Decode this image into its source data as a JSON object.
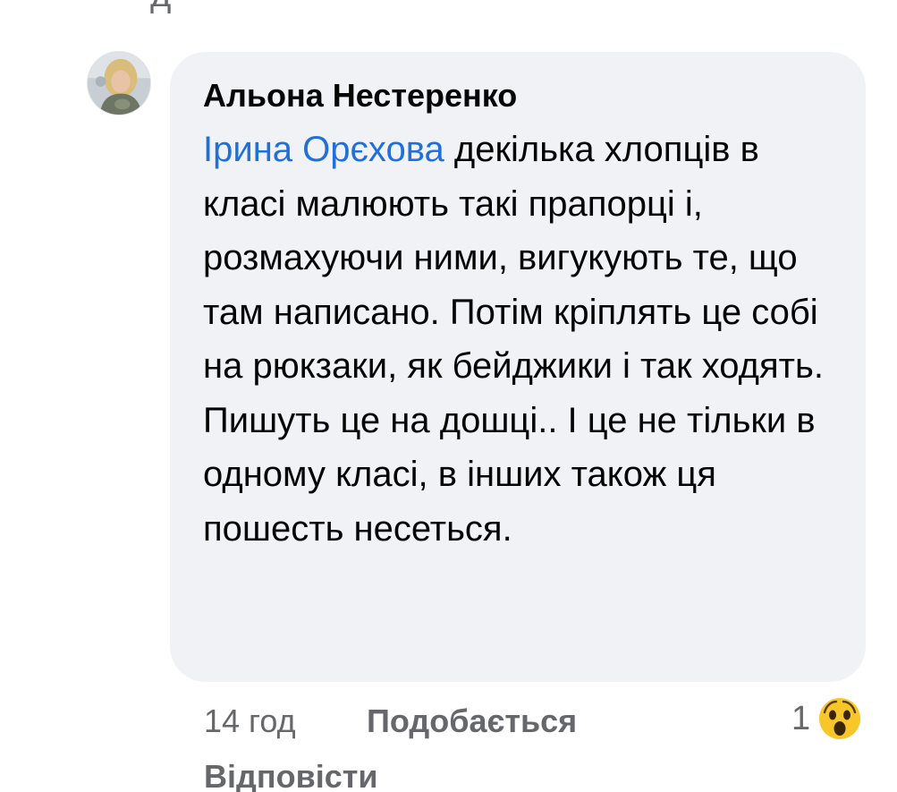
{
  "previous_fragment": "д",
  "comment": {
    "author": "Альона Нестеренко",
    "mention": "Ірина Орєхова",
    "text": " декілька хлопців в класі малюють такі прапорці і, розмахуючи ними, вигукують те, що там написано. Потім кріплять це собі на рюкзаки, як бейджики і так ходять. Пишуть це на дошці.. І це не тільки в одному класі, в інших також ця пошесть несеться.",
    "avatar_icon": "user-avatar-photo"
  },
  "actions": {
    "time": "14 год",
    "like_label": "Подобається",
    "reply_label": "Відповісти"
  },
  "reactions": {
    "count": "1",
    "icon": "wow-emoji-icon"
  },
  "colors": {
    "bubble": "#f0f2f5",
    "mention": "#216fdb",
    "secondary_text": "#65676b",
    "primary_text": "#050505"
  }
}
